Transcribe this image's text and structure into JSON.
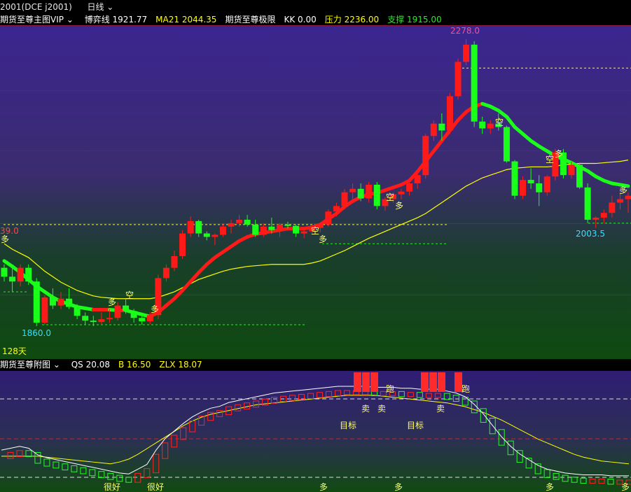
{
  "title_bar": {
    "contract": "2001(DCE j2001)",
    "period": "日线"
  },
  "main_header": {
    "indicator_name": "期货至尊主图VIP",
    "items": [
      {
        "label": "博弈线",
        "value": "1921.77",
        "color": "#ffffff"
      },
      {
        "label": "MA21",
        "value": "2044.35",
        "color": "#ffff00"
      },
      {
        "label": "期货至尊极限",
        "value": "",
        "color": "#ffffff"
      },
      {
        "label": "KK",
        "value": "0.00",
        "color": "#ffffff"
      },
      {
        "label": "压力",
        "value": "2236.00",
        "color": "#ffff00"
      },
      {
        "label": "支撑",
        "value": "1915.00",
        "color": "#2ee62e"
      }
    ]
  },
  "sub_header": {
    "indicator_name": "期货至尊附图",
    "items": [
      {
        "label": "QS",
        "value": "20.08",
        "color": "#ffffff"
      },
      {
        "label": "B",
        "value": "16.50",
        "color": "#ffff00"
      },
      {
        "label": "ZLX",
        "value": "18.07",
        "color": "#ffff00"
      }
    ]
  },
  "main_labels": {
    "high": "2278.0",
    "low": "1860.0",
    "local_low": "2003.5",
    "left_edge_price": "39.0",
    "days": "128天"
  },
  "colors": {
    "up": "#ff1a1a",
    "down": "#1aff1a",
    "ma": "#ffff00",
    "qs": "#ffffff"
  },
  "chart_data": {
    "type": "candlestick",
    "candles": [
      [
        1945,
        1950,
        1925,
        1932
      ],
      [
        1932,
        1945,
        1910,
        1925
      ],
      [
        1925,
        1950,
        1918,
        1945
      ],
      [
        1945,
        1950,
        1920,
        1925
      ],
      [
        1925,
        1930,
        1860,
        1865
      ],
      [
        1865,
        1905,
        1862,
        1902
      ],
      [
        1902,
        1915,
        1885,
        1890
      ],
      [
        1890,
        1910,
        1885,
        1900
      ],
      [
        1900,
        1915,
        1885,
        1888
      ],
      [
        1888,
        1892,
        1870,
        1875
      ],
      [
        1875,
        1880,
        1862,
        1868
      ],
      [
        1868,
        1875,
        1860,
        1866
      ],
      [
        1866,
        1880,
        1862,
        1870
      ],
      [
        1870,
        1885,
        1865,
        1872
      ],
      [
        1872,
        1895,
        1868,
        1890
      ],
      [
        1890,
        1900,
        1878,
        1882
      ],
      [
        1882,
        1885,
        1865,
        1872
      ],
      [
        1872,
        1878,
        1862,
        1867
      ],
      [
        1867,
        1880,
        1863,
        1876
      ],
      [
        1876,
        1935,
        1870,
        1930
      ],
      [
        1930,
        1950,
        1925,
        1945
      ],
      [
        1945,
        1970,
        1940,
        1962
      ],
      [
        1962,
        2000,
        1958,
        1995
      ],
      [
        1995,
        2020,
        1990,
        2013
      ],
      [
        2013,
        2015,
        1990,
        1995
      ],
      [
        1995,
        1998,
        1985,
        1990
      ],
      [
        1990,
        1995,
        1978,
        1993
      ],
      [
        1993,
        2010,
        1990,
        2005
      ],
      [
        2005,
        2015,
        1995,
        2010
      ],
      [
        2010,
        2022,
        2005,
        2015
      ],
      [
        2015,
        2022,
        2005,
        2008
      ],
      [
        2008,
        2015,
        1990,
        1993
      ],
      [
        1993,
        2010,
        1990,
        2005
      ],
      [
        2005,
        2018,
        1995,
        2000
      ],
      [
        2000,
        2010,
        1990,
        2008
      ],
      [
        2008,
        2012,
        2002,
        2006
      ],
      [
        2006,
        2008,
        1990,
        1995
      ],
      [
        1995,
        2003,
        1988,
        1998
      ],
      [
        1998,
        2005,
        1995,
        2003
      ],
      [
        2003,
        2010,
        1997,
        2008
      ],
      [
        2008,
        2030,
        2005,
        2027
      ],
      [
        2027,
        2040,
        2020,
        2035
      ],
      [
        2035,
        2060,
        2030,
        2055
      ],
      [
        2055,
        2068,
        2045,
        2060
      ],
      [
        2060,
        2068,
        2042,
        2046
      ],
      [
        2046,
        2070,
        2040,
        2066
      ],
      [
        2066,
        2070,
        2030,
        2035
      ],
      [
        2035,
        2048,
        2028,
        2045
      ],
      [
        2045,
        2055,
        2040,
        2052
      ],
      [
        2052,
        2060,
        2045,
        2056
      ],
      [
        2056,
        2070,
        2050,
        2068
      ],
      [
        2068,
        2085,
        2060,
        2080
      ],
      [
        2080,
        2140,
        2075,
        2137
      ],
      [
        2137,
        2160,
        2130,
        2155
      ],
      [
        2155,
        2170,
        2130,
        2145
      ],
      [
        2145,
        2200,
        2140,
        2195
      ],
      [
        2195,
        2250,
        2190,
        2245
      ],
      [
        2245,
        2278,
        2240,
        2270
      ],
      [
        2270,
        2275,
        2150,
        2158
      ],
      [
        2158,
        2165,
        2140,
        2148
      ],
      [
        2148,
        2160,
        2140,
        2155
      ],
      [
        2155,
        2170,
        2145,
        2150
      ],
      [
        2150,
        2152,
        2098,
        2100
      ],
      [
        2100,
        2102,
        2045,
        2050
      ],
      [
        2050,
        2078,
        2045,
        2073
      ],
      [
        2073,
        2090,
        2060,
        2068
      ],
      [
        2068,
        2080,
        2035,
        2055
      ],
      [
        2055,
        2080,
        2050,
        2078
      ],
      [
        2078,
        2118,
        2072,
        2113
      ],
      [
        2113,
        2118,
        2075,
        2080
      ],
      [
        2080,
        2100,
        2075,
        2095
      ],
      [
        2095,
        2098,
        2060,
        2062
      ],
      [
        2062,
        2068,
        2010,
        2015
      ],
      [
        2015,
        2020,
        2003,
        2018
      ],
      [
        2018,
        2030,
        2010,
        2025
      ],
      [
        2025,
        2050,
        2018,
        2040
      ],
      [
        2040,
        2060,
        2030,
        2045
      ],
      [
        2045,
        2055,
        2025,
        2050
      ]
    ],
    "ma21": [
      1980,
      1972,
      1966,
      1960,
      1950,
      1940,
      1932,
      1924,
      1918,
      1912,
      1908,
      1904,
      1902,
      1901,
      1900,
      1900,
      1900,
      1900,
      1900,
      1902,
      1906,
      1910,
      1916,
      1922,
      1928,
      1932,
      1936,
      1940,
      1943,
      1945,
      1947,
      1948,
      1949,
      1950,
      1950,
      1950,
      1950,
      1950,
      1952,
      1955,
      1960,
      1965,
      1970,
      1976,
      1982,
      1988,
      1993,
      1998,
      2003,
      2008,
      2013,
      2018,
      2024,
      2032,
      2040,
      2048,
      2056,
      2064,
      2070,
      2076,
      2080,
      2084,
      2088,
      2090,
      2091,
      2092,
      2092,
      2092,
      2093,
      2095,
      2096,
      2097,
      2097,
      2097,
      2098,
      2099,
      2100,
      2102
    ],
    "game_line": [
      1955,
      1947,
      1938,
      1928,
      1918,
      1910,
      1902,
      1896,
      1892,
      1888,
      1886,
      1884,
      1884,
      1884,
      1883,
      1883,
      1880,
      1877,
      1874,
      1880,
      1890,
      1900,
      1912,
      1925,
      1938,
      1950,
      1960,
      1968,
      1976,
      1984,
      1990,
      1994,
      1996,
      1998,
      2000,
      2002,
      2002,
      2002,
      2004,
      2008,
      2016,
      2024,
      2034,
      2042,
      2048,
      2052,
      2054,
      2058,
      2062,
      2066,
      2072,
      2085,
      2100,
      2115,
      2130,
      2145,
      2160,
      2172,
      2180,
      2184,
      2180,
      2174,
      2165,
      2150,
      2140,
      2130,
      2122,
      2115,
      2108,
      2103,
      2098,
      2092,
      2086,
      2078,
      2072,
      2068,
      2066,
      2064
    ],
    "sub": {
      "qs": [
        60,
        62,
        64,
        62,
        55,
        52,
        50,
        48,
        46,
        44,
        42,
        40,
        38,
        36,
        35,
        40,
        45,
        60,
        72,
        80,
        88,
        95,
        100,
        104,
        106,
        110,
        112,
        114,
        116,
        118,
        120,
        121,
        122,
        123,
        124,
        125,
        126,
        127,
        127,
        127,
        127,
        126,
        126,
        126,
        125,
        125,
        124,
        124,
        124,
        122,
        120,
        116,
        108,
        98,
        86,
        74,
        64,
        56,
        50,
        44,
        40,
        38,
        36,
        35,
        34,
        34,
        34,
        33,
        33,
        33
      ],
      "b": [
        58,
        58,
        58,
        58,
        58,
        57,
        56,
        55,
        54,
        53,
        52,
        51,
        50,
        52,
        55,
        60,
        66,
        72,
        78,
        84,
        90,
        95,
        99,
        102,
        104,
        106,
        108,
        110,
        112,
        113,
        114,
        115,
        116,
        117,
        118,
        119,
        120,
        121,
        122,
        122,
        122,
        122,
        121,
        120,
        119,
        118,
        117,
        116,
        115,
        114,
        112,
        110,
        107,
        104,
        100,
        96,
        91,
        86,
        81,
        76,
        72,
        68,
        64,
        60,
        57,
        55,
        53,
        52,
        51,
        50
      ]
    }
  },
  "signals": {
    "main": [
      "多",
      "空",
      "多",
      "空",
      "多",
      "空",
      "多",
      "空",
      "多",
      "空",
      "多",
      "多"
    ],
    "sub": [
      "跑",
      "跑",
      "卖",
      "卖",
      "卖",
      "目标",
      "目标",
      "很好",
      "很好",
      "多",
      "多",
      "多",
      "多"
    ]
  }
}
